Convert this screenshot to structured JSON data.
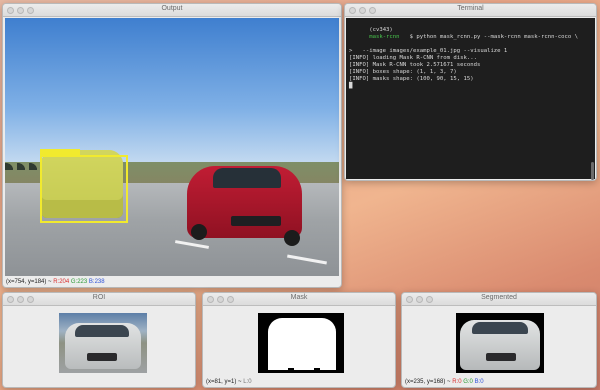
{
  "windows": {
    "output": {
      "title": "Output",
      "status": {
        "coords": "(x=754, y=184) ~",
        "r": "R:204",
        "g": "G:223",
        "b": "B:238"
      }
    },
    "terminal": {
      "title": "Terminal",
      "lines": [
        {
          "env": "(cv343)",
          "dir": "mask-rcnn",
          "cmd": "   $ python mask_rcnn.py --mask-rcnn mask-rcnn-coco \\"
        },
        {
          "text": ">   --image images/example_01.jpg --visualize 1"
        },
        {
          "text": "[INFO] loading Mask R-CNN from disk..."
        },
        {
          "text": "[INFO] Mask R-CNN took 2.571671 seconds"
        },
        {
          "text": "[INFO] boxes shape: (1, 1, 3, 7)"
        },
        {
          "text": "[INFO] masks shape: (100, 90, 15, 15)"
        },
        {
          "text": "█"
        }
      ]
    },
    "roi": {
      "title": "ROI"
    },
    "mask": {
      "title": "Mask",
      "status": {
        "coords": "(x=81, y=1) ~",
        "l": "L:0"
      }
    },
    "segmented": {
      "title": "Segmented",
      "status": {
        "coords": "(x=235, y=168) ~",
        "r": "R:0",
        "g": "G:0",
        "b": "B:0"
      }
    }
  },
  "colors": {
    "mask_overlay": "#d6dc36",
    "bbox": "#f1ea2e",
    "terminal_bg": "#1e1e1e",
    "prompt_green": "#48c44c"
  }
}
